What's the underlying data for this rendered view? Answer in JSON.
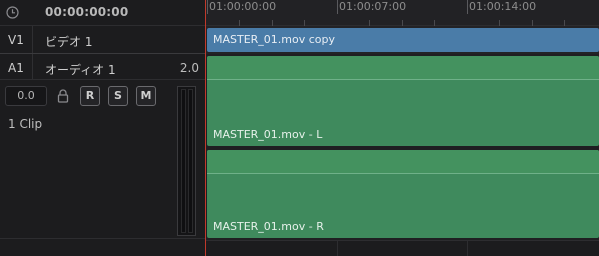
{
  "header": {
    "timecode": "00:00:00:00",
    "icon": "clock-icon"
  },
  "tracks": {
    "v1": {
      "id": "V1",
      "name": "ビデオ 1"
    },
    "a1": {
      "id": "A1",
      "name": "オーディオ 1",
      "volume": "2.0"
    }
  },
  "a1_controls": {
    "level": "0.0",
    "lock_icon": "lock-icon",
    "record_label": "R",
    "solo_label": "S",
    "mute_label": "M",
    "clip_count": "1 Clip"
  },
  "ruler": {
    "labels": [
      "01:00:00:00",
      "01:00:07:00",
      "01:00:14:00"
    ]
  },
  "clips": {
    "video": {
      "name": "MASTER_01.mov copy",
      "color": "#4a7ca8"
    },
    "audio_l": {
      "name": "MASTER_01.mov - L",
      "color": "#3f8a5d"
    },
    "audio_r": {
      "name": "MASTER_01.mov - R",
      "color": "#3f8a5d"
    }
  },
  "colors": {
    "playhead": "#c0392b",
    "background": "#1c1c1e"
  }
}
